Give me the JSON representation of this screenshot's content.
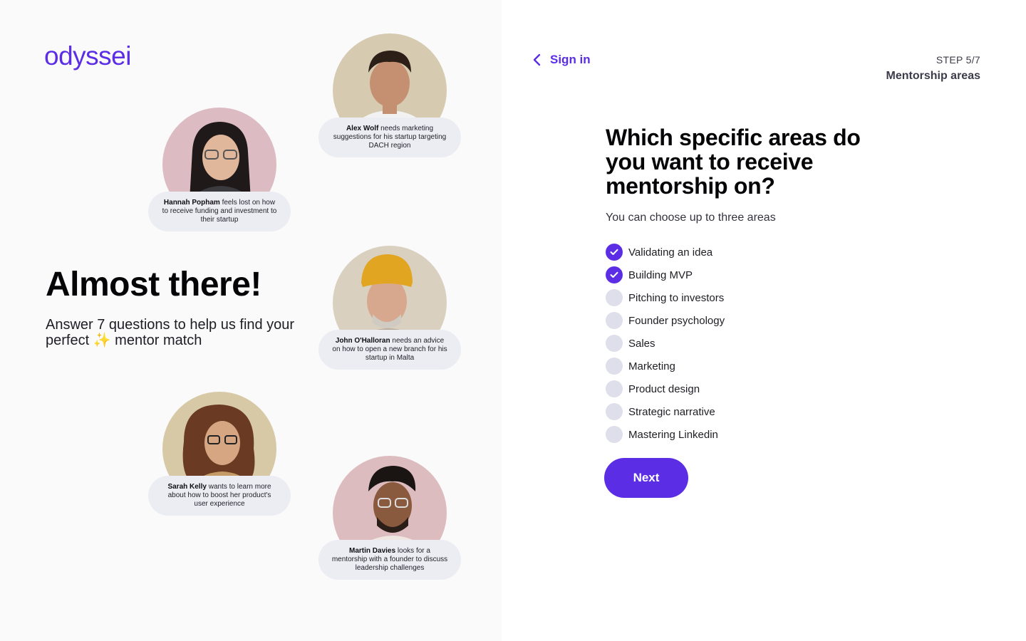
{
  "brand": {
    "logo_text": "odyssei",
    "accent": "#5b2ee6"
  },
  "hero": {
    "title": "Almost there!",
    "subtitle_before": "Answer 7 questions to help us find your perfect ",
    "sparkle": "✨",
    "subtitle_after": " mentor match"
  },
  "people": [
    {
      "name": "Alex Wolf",
      "text": " needs marketing suggestions for his startup targeting DACH region",
      "bg": "#d6cbb0"
    },
    {
      "name": "Hannah Popham",
      "text": " feels lost on how to receive funding and investment to their startup",
      "bg": "#dcbcc2"
    },
    {
      "name": "John O'Halloran",
      "text": " needs an advice on how to open a new branch for his startup in Malta",
      "bg": "#dad0bf"
    },
    {
      "name": "Sarah Kelly",
      "text": " wants to learn more about how to boost her product's user experience",
      "bg": "#d8c9a6"
    },
    {
      "name": "Martin Davies",
      "text": " looks for a mentorship with a founder to discuss leadership challenges",
      "bg": "#dcbcbe"
    }
  ],
  "nav": {
    "back_label": "Sign in",
    "back_icon": "chevron-left-icon"
  },
  "step": {
    "number": "STEP 5/7",
    "name": "Mentorship areas"
  },
  "question": {
    "title": "Which specific areas do you want to receive mentorship on?",
    "hint": "You can choose up to three areas"
  },
  "options": [
    {
      "label": "Validating an idea",
      "checked": true
    },
    {
      "label": "Building MVP",
      "checked": true
    },
    {
      "label": "Pitching to investors",
      "checked": false
    },
    {
      "label": "Founder psychology",
      "checked": false
    },
    {
      "label": "Sales",
      "checked": false
    },
    {
      "label": "Marketing",
      "checked": false
    },
    {
      "label": "Product design",
      "checked": false
    },
    {
      "label": "Strategic narrative",
      "checked": false
    },
    {
      "label": "Mastering Linkedin",
      "checked": false
    }
  ],
  "next_button": {
    "label": "Next"
  }
}
